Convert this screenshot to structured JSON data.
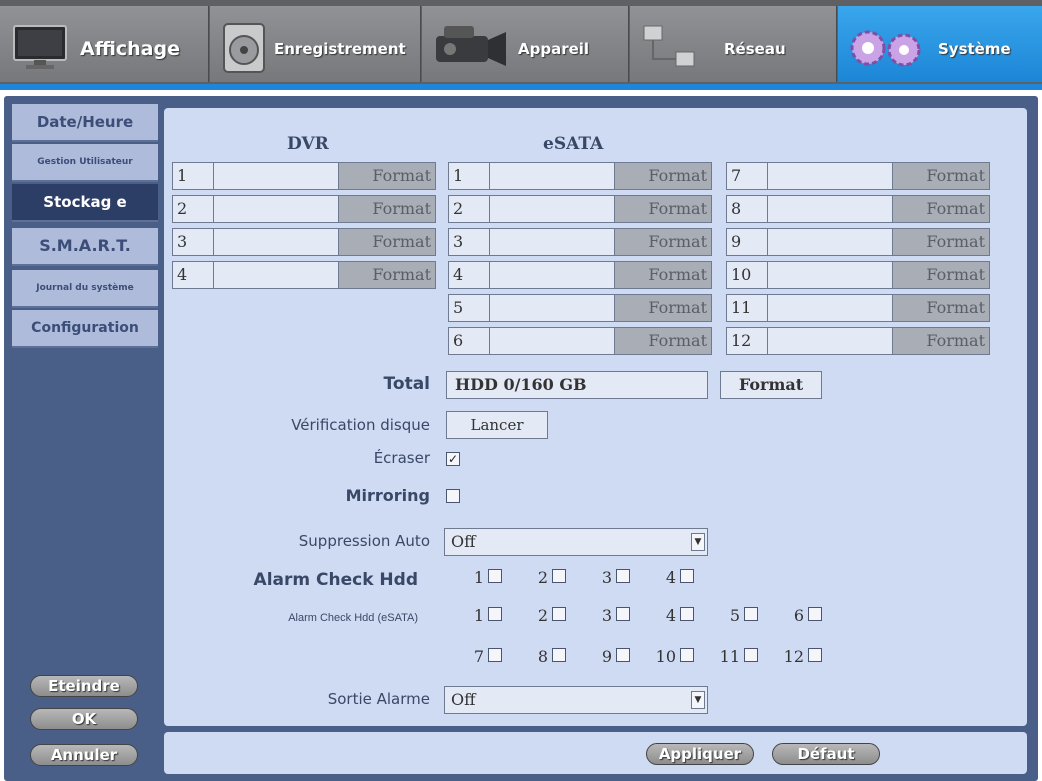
{
  "tabs": [
    {
      "label": "Affichage",
      "icon": "monitor-icon"
    },
    {
      "label": "Enregistrement",
      "icon": "disk-icon"
    },
    {
      "label": "Appareil",
      "icon": "camera-icon"
    },
    {
      "label": "Réseau",
      "icon": "network-icon"
    },
    {
      "label": "Système",
      "icon": "gears-icon"
    }
  ],
  "menu": {
    "items": [
      "Date/Heure",
      "Gestion Utilisateur",
      "Stockag e",
      "S.M.A.R.T.",
      "Journal du système",
      "Configuration"
    ],
    "active": "Stockag e"
  },
  "side_buttons": {
    "shutdown": "Eteindre",
    "ok": "OK",
    "cancel": "Annuler"
  },
  "storage": {
    "dvr_header": "DVR",
    "esata_header": "eSATA",
    "format_label": "Format",
    "dvr_slots": [
      "1",
      "2",
      "3",
      "4"
    ],
    "esata_col1": [
      "1",
      "2",
      "3",
      "4",
      "5",
      "6"
    ],
    "esata_col2": [
      "7",
      "8",
      "9",
      "10",
      "11",
      "12"
    ]
  },
  "total": {
    "label": "Total",
    "value": "HDD 0/160 GB",
    "button": "Format"
  },
  "disk_check": {
    "label": "Vérification disque",
    "button": "Lancer"
  },
  "overwrite": {
    "label": "Écraser",
    "checked": true
  },
  "mirroring": {
    "label": "Mirroring",
    "checked": false
  },
  "auto_delete": {
    "label": "Suppression Auto",
    "value": "Off"
  },
  "alarm_check": {
    "label": "Alarm Check Hdd",
    "items": [
      "1",
      "2",
      "3",
      "4"
    ]
  },
  "alarm_check_esata": {
    "label": "Alarm Check Hdd (eSATA)",
    "items": [
      "1",
      "2",
      "3",
      "4",
      "5",
      "6",
      "7",
      "8",
      "9",
      "10",
      "11",
      "12"
    ]
  },
  "alarm_output": {
    "label": "Sortie Alarme",
    "value": "Off"
  },
  "footer": {
    "apply": "Appliquer",
    "default": "Défaut"
  },
  "colors": {
    "active_tab": "#1f85d8",
    "panel": "#cfdbf2",
    "frame": "#4a5f87",
    "menu_active": "#2d3e66"
  }
}
